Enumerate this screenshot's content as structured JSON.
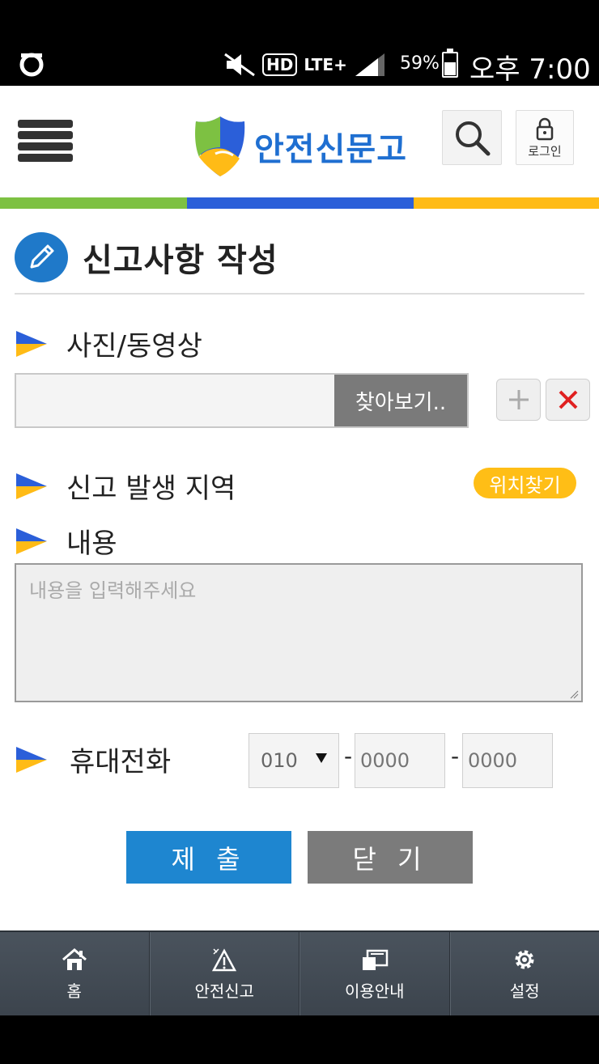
{
  "status_bar": {
    "battery": "59%",
    "time": "오후 7:00",
    "network": "LTE+",
    "hd_label": "HD"
  },
  "header": {
    "brand": "안전신문고",
    "login_label": "로그인"
  },
  "page": {
    "title": "신고사항 작성"
  },
  "form": {
    "photo_label": "사진/동영상",
    "browse_label": "찾아보기..",
    "location_label": "신고 발생 지역",
    "locate_button": "위치찾기",
    "content_label": "내용",
    "content_placeholder": "내용을 입력해주세요",
    "phone_label": "휴대전화",
    "phone_prefix": "010",
    "phone_mid_placeholder": "0000",
    "phone_last_placeholder": "0000",
    "dash": "-",
    "submit_label": "제 출",
    "close_label": "닫 기"
  },
  "bottom_nav": {
    "items": [
      {
        "label": "홈",
        "icon": "home-icon"
      },
      {
        "label": "안전신고",
        "icon": "safety-report-icon"
      },
      {
        "label": "이용안내",
        "icon": "guide-icon"
      },
      {
        "label": "설정",
        "icon": "gear-icon"
      }
    ]
  },
  "colors": {
    "brand_blue": "#1f6fd1",
    "green": "#7dc142",
    "yellow": "#ffbb16",
    "submit_blue": "#1e86d0"
  }
}
